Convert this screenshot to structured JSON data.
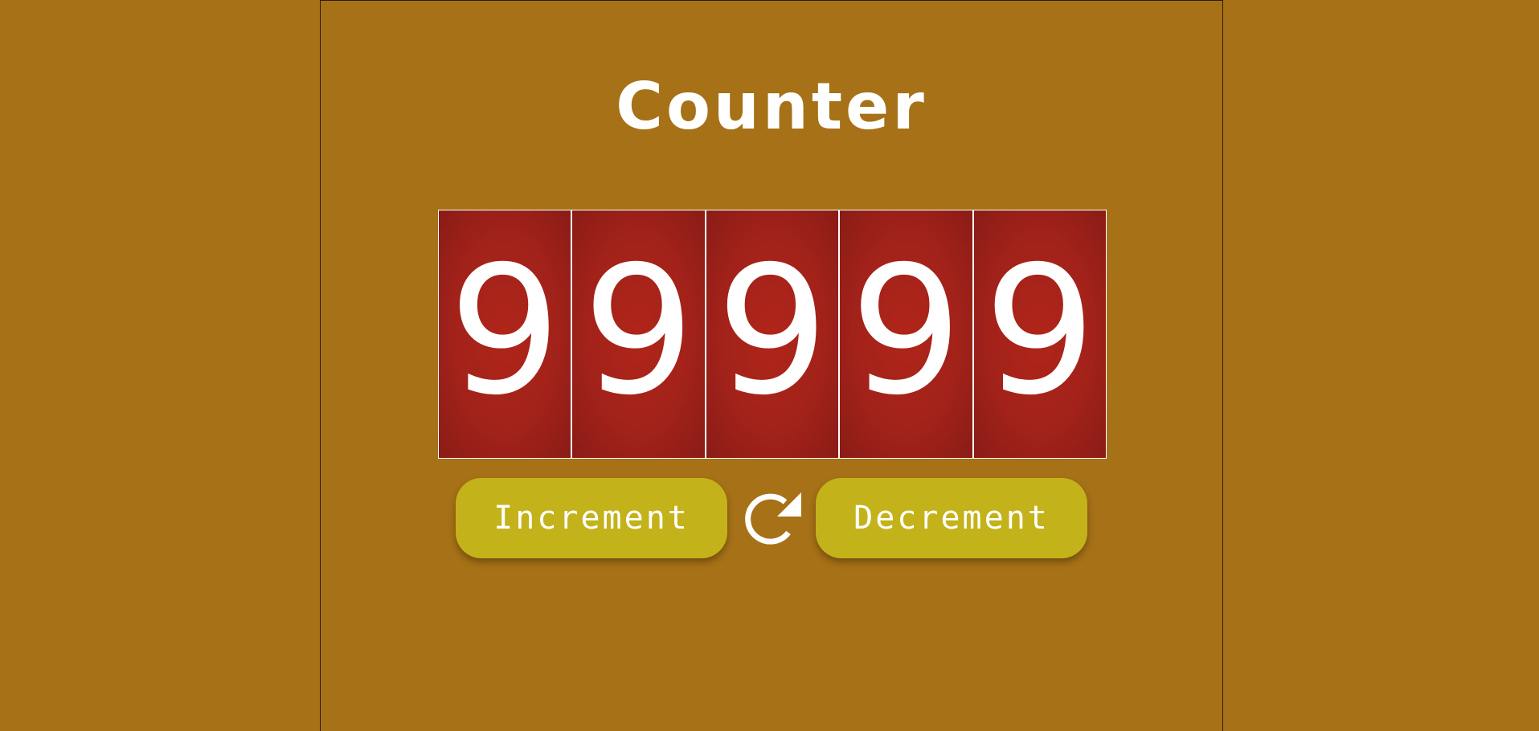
{
  "app": {
    "title": "Counter"
  },
  "counter": {
    "value": 99999,
    "digits": [
      "9",
      "9",
      "9",
      "9",
      "9"
    ]
  },
  "controls": {
    "increment_label": "Increment",
    "decrement_label": "Decrement",
    "reset_icon": "refresh-icon"
  },
  "colors": {
    "background": "#a67117",
    "digit_panel": "#a2221a",
    "button": "#c4b21a",
    "text": "#ffffff"
  }
}
